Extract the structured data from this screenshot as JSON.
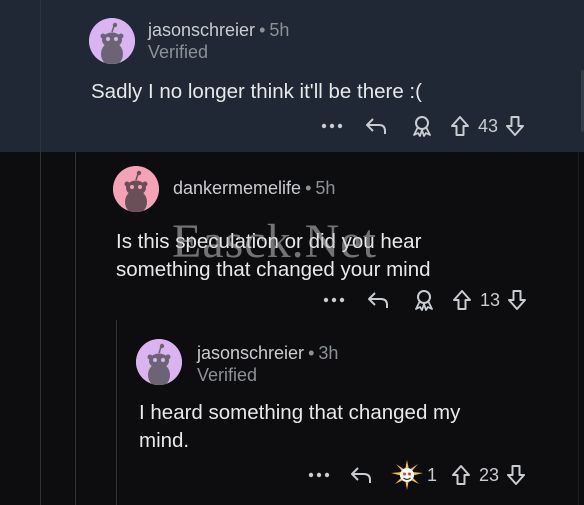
{
  "comments": [
    {
      "username": "jasonschreier",
      "separator": "•",
      "time": "5h",
      "flair": "Verified",
      "body": "Sadly I no longer think it'll be there :(",
      "votes": "43"
    },
    {
      "username": "dankermemelife",
      "separator": "•",
      "time": "5h",
      "flair": "",
      "body": "Is this speculation or did you hear\nsomething that changed your mind",
      "votes": "13"
    },
    {
      "username": "jasonschreier",
      "separator": "•",
      "time": "3h",
      "flair": "Verified",
      "body": "I heard something that changed my\nmind.",
      "award_count": "1",
      "votes": "23"
    }
  ],
  "watermark": "Easck.Net",
  "colors": {
    "avatar_purple": "#dab4f0",
    "avatar_pink": "#f3a3b5",
    "selected_bg": "#1f2834"
  },
  "icons": [
    "more-icon",
    "reply-icon",
    "award-icon",
    "upvote-icon",
    "downvote-icon"
  ]
}
